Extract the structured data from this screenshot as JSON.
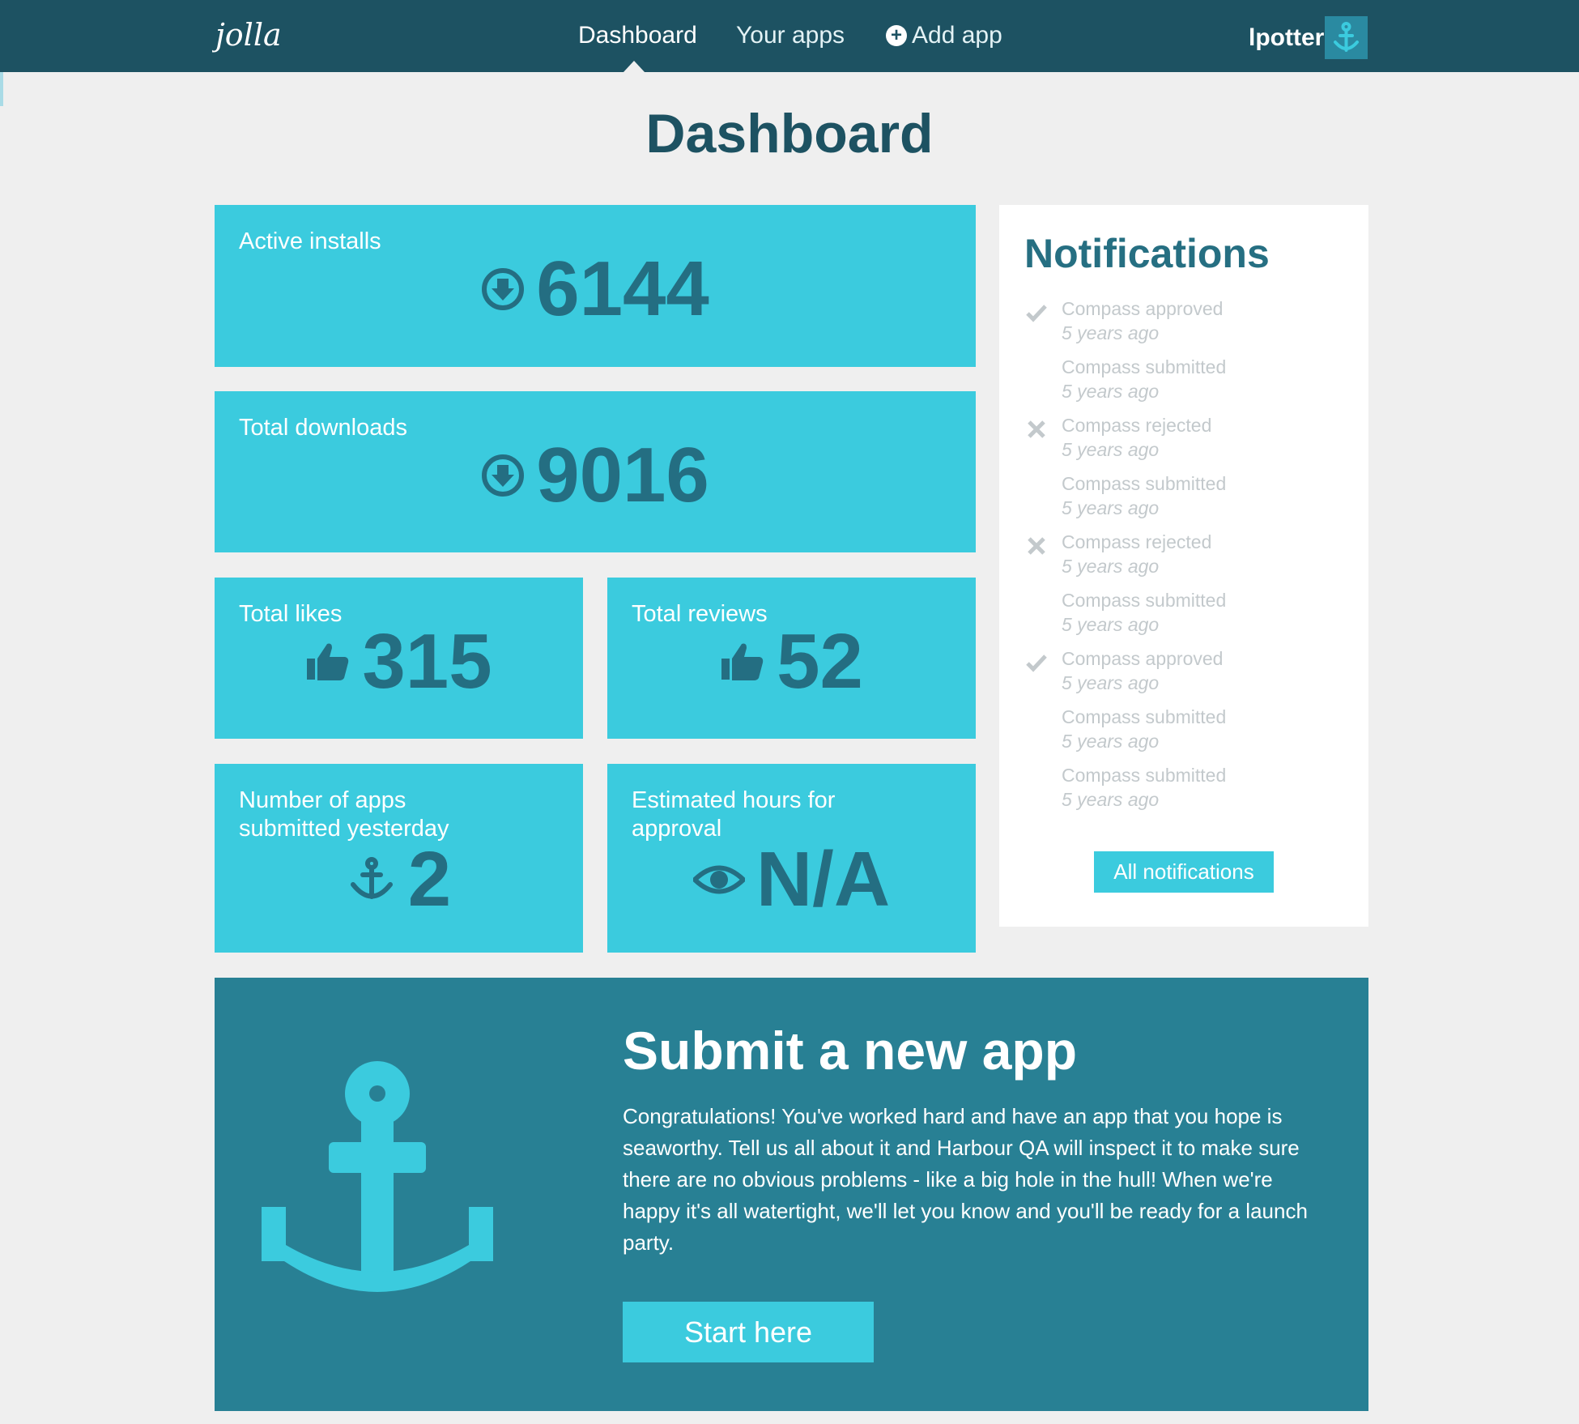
{
  "header": {
    "logo_text": "jolla",
    "nav": {
      "dashboard": "Dashboard",
      "your_apps": "Your apps",
      "add_app": "Add app"
    },
    "user_name": "lpotter"
  },
  "page_title": "Dashboard",
  "stats": {
    "active_installs": {
      "label": "Active installs",
      "value": "6144",
      "icon": "download-circle-icon"
    },
    "total_downloads": {
      "label": "Total downloads",
      "value": "9016",
      "icon": "download-circle-icon"
    },
    "total_likes": {
      "label": "Total likes",
      "value": "315",
      "icon": "thumbs-up-icon"
    },
    "total_reviews": {
      "label": "Total reviews",
      "value": "52",
      "icon": "thumbs-up-icon"
    },
    "apps_submitted": {
      "label_line1": "Number of apps",
      "label_line2": "submitted yesterday",
      "value": "2",
      "icon": "anchor-icon"
    },
    "approval_hours": {
      "label_line1": "Estimated hours for",
      "label_line2": "approval",
      "value": "N/A",
      "icon": "eye-icon"
    }
  },
  "notifications": {
    "title": "Notifications",
    "items": [
      {
        "text": "Compass approved",
        "time": "5 years ago",
        "status": "approved"
      },
      {
        "text": "Compass submitted",
        "time": "5 years ago",
        "status": "submitted"
      },
      {
        "text": "Compass rejected",
        "time": "5 years ago",
        "status": "rejected"
      },
      {
        "text": "Compass submitted",
        "time": "5 years ago",
        "status": "submitted"
      },
      {
        "text": "Compass rejected",
        "time": "5 years ago",
        "status": "rejected"
      },
      {
        "text": "Compass submitted",
        "time": "5 years ago",
        "status": "submitted"
      },
      {
        "text": "Compass approved",
        "time": "5 years ago",
        "status": "approved"
      },
      {
        "text": "Compass submitted",
        "time": "5 years ago",
        "status": "submitted"
      },
      {
        "text": "Compass submitted",
        "time": "5 years ago",
        "status": "submitted"
      }
    ],
    "all_button": "All notifications"
  },
  "submit": {
    "title": "Submit a new app",
    "text": "Congratulations! You've worked hard and have an app that you hope is seaworthy. Tell us all about it and Harbour QA will inspect it to make sure there are no obvious problems - like a big hole in the hull! When we're happy it's all watertight, we'll let you know and you'll be ready for a launch party.",
    "button": "Start here"
  },
  "colors": {
    "header_bg": "#1d5262",
    "card_bg": "#3bcbde",
    "value_text": "#246e82",
    "banner_bg": "#288094",
    "page_bg": "#efefef"
  }
}
